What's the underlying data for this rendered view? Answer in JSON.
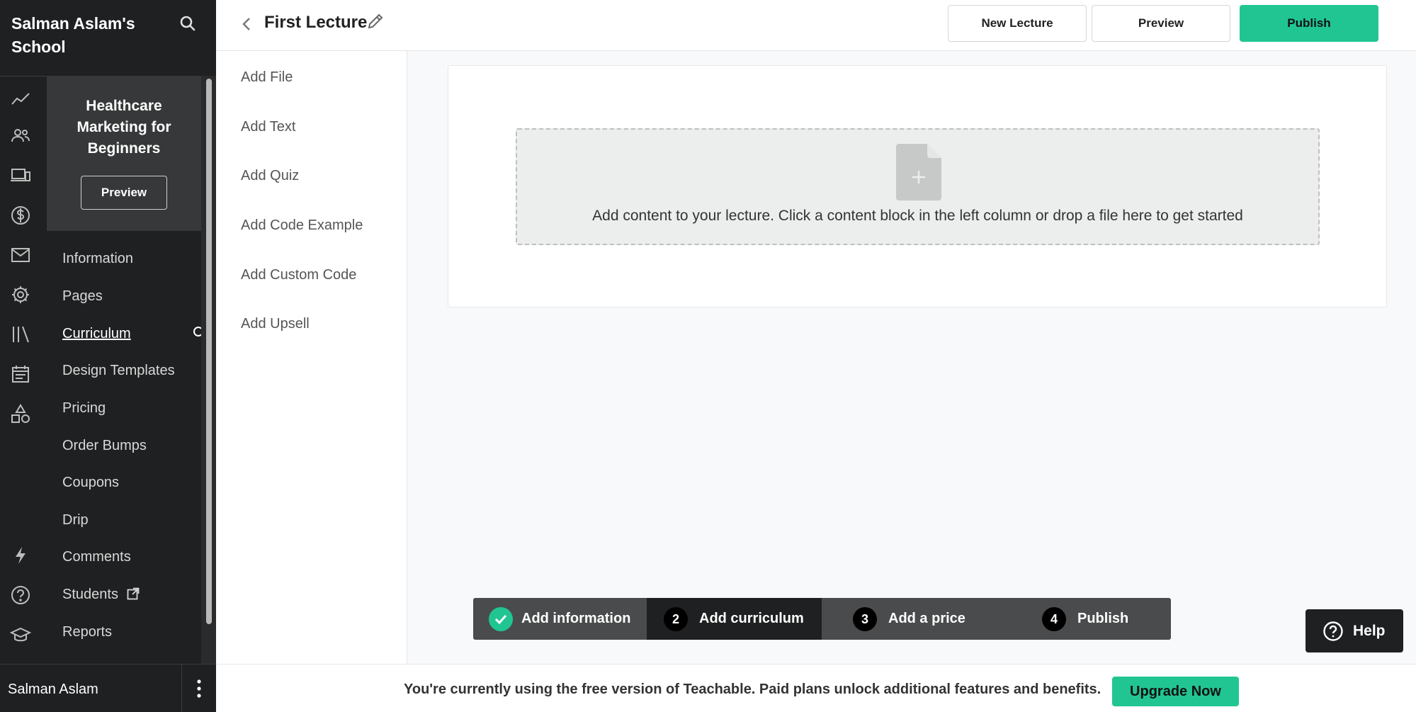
{
  "school": {
    "name": "Salman Aslam's School"
  },
  "icons": {
    "search": "search-icon",
    "rail": [
      "analytics-icon",
      "users-icon",
      "devices-icon",
      "dollar-icon",
      "mail-icon",
      "gear-icon",
      "library-icon",
      "calendar-icon",
      "shapes-icon",
      "bolt-icon",
      "help-circle-icon",
      "graduation-cap-icon"
    ]
  },
  "course": {
    "title": "Healthcare Marketing for Beginners",
    "preview_label": "Preview"
  },
  "menu": [
    {
      "label": "Information"
    },
    {
      "label": "Pages"
    },
    {
      "label": "Curriculum"
    },
    {
      "label": "Design Templates"
    },
    {
      "label": "Pricing"
    },
    {
      "label": "Order Bumps"
    },
    {
      "label": "Coupons"
    },
    {
      "label": "Drip"
    },
    {
      "label": "Comments"
    },
    {
      "label": "Students"
    },
    {
      "label": "Reports"
    }
  ],
  "user": {
    "name": "Salman Aslam"
  },
  "header": {
    "lecture_title": "First Lecture",
    "new_lecture_label": "New Lecture",
    "preview_label": "Preview",
    "publish_label": "Publish"
  },
  "blocks": [
    {
      "label": "Add File"
    },
    {
      "label": "Add Text"
    },
    {
      "label": "Add Quiz"
    },
    {
      "label": "Add Code Example"
    },
    {
      "label": "Add Custom Code"
    },
    {
      "label": "Add Upsell"
    }
  ],
  "editor": {
    "drop_text": "Add content to your lecture. Click a content block in the left column or drop a file here to get started"
  },
  "stepper": [
    {
      "num": "",
      "label": "Add information"
    },
    {
      "num": "2",
      "label": "Add curriculum"
    },
    {
      "num": "3",
      "label": "Add a price"
    },
    {
      "num": "4",
      "label": "Publish"
    }
  ],
  "help": {
    "label": "Help"
  },
  "banner": {
    "text": "You're currently using the free version of Teachable. Paid plans unlock additional features and benefits.",
    "upgrade_label": "Upgrade Now"
  },
  "colors": {
    "accent": "#21c592",
    "sidebar": "#1f2021",
    "card": "#373839"
  }
}
